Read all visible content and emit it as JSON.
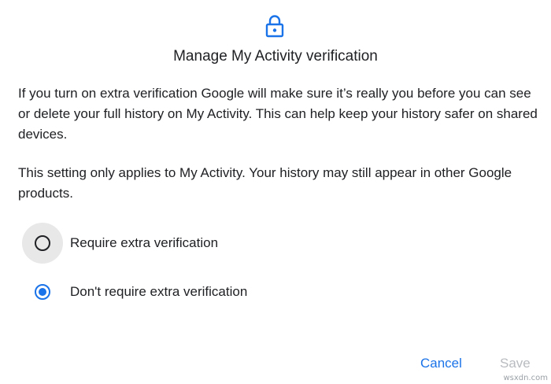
{
  "dialog": {
    "title": "Manage My Activity verification",
    "paragraphs": [
      "If you turn on extra verification Google will make sure it’s really you before you can see or delete your full history on My Activity. This can help keep your history safer on shared devices.",
      "This setting only applies to My Activity. Your history may still appear in other Google products."
    ],
    "options": [
      {
        "label": "Require extra verification",
        "selected": false
      },
      {
        "label": "Don't require extra verification",
        "selected": true
      }
    ],
    "buttons": {
      "cancel": "Cancel",
      "save": "Save"
    }
  },
  "icons": {
    "header": "lock-icon"
  },
  "colors": {
    "accent": "#1a73e8",
    "text": "#202124",
    "disabled": "#b8bbbf",
    "hover_halo": "#e8e8e8"
  },
  "watermark": "wsxdn.com"
}
